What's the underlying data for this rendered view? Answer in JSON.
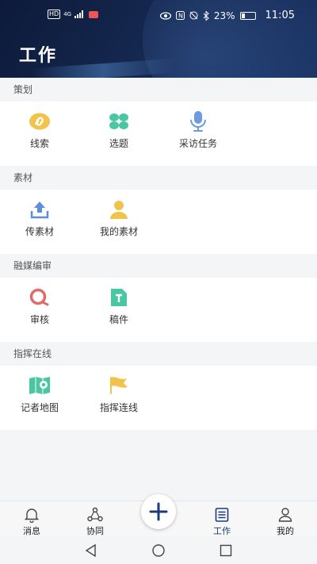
{
  "status_bar": {
    "signal_left": "HD",
    "signal_4g": "4G",
    "battery": "23%",
    "time": "11:05"
  },
  "header": {
    "title": "工作"
  },
  "sections": [
    {
      "title": "策划",
      "items": [
        {
          "label": "线索",
          "icon": "link-icon"
        },
        {
          "label": "选题",
          "icon": "clover-icon"
        },
        {
          "label": "采访任务",
          "icon": "microphone-icon"
        }
      ]
    },
    {
      "title": "素材",
      "items": [
        {
          "label": "传素材",
          "icon": "upload-icon"
        },
        {
          "label": "我的素材",
          "icon": "user-icon"
        }
      ]
    },
    {
      "title": "融媒编审",
      "items": [
        {
          "label": "审核",
          "icon": "review-search-icon"
        },
        {
          "label": "稿件",
          "icon": "document-text-icon"
        }
      ]
    },
    {
      "title": "指挥在线",
      "items": [
        {
          "label": "记者地图",
          "icon": "map-pin-icon"
        },
        {
          "label": "指挥连线",
          "icon": "flag-icon"
        }
      ]
    }
  ],
  "tabbar": {
    "items": [
      {
        "label": "消息",
        "icon": "bell-icon"
      },
      {
        "label": "协同",
        "icon": "collaborate-icon"
      },
      {
        "label": "工作",
        "icon": "list-icon",
        "active": true
      },
      {
        "label": "我的",
        "icon": "profile-icon"
      }
    ],
    "fab_icon": "plus-icon"
  },
  "colors": {
    "header_bg": "#13254b",
    "accent": "#1d3a7a",
    "link_yellow": "#f2c34b",
    "green": "#4ac6a4",
    "blue": "#5b8fde",
    "red": "#e06b6b"
  }
}
